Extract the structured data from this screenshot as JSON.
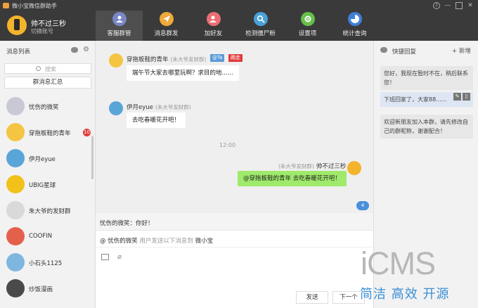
{
  "window": {
    "title": "微小宝微信群助手",
    "controls": [
      "?",
      "—",
      "□",
      "✕"
    ]
  },
  "profile": {
    "name": "帅不过三秒",
    "subtitle": "切换账号"
  },
  "nav": {
    "items": [
      {
        "label": "客服群管",
        "color": "#7b86c6",
        "active": true
      },
      {
        "label": "消息群发",
        "color": "#f0a93a",
        "active": false
      },
      {
        "label": "加好友",
        "color": "#ea6e73",
        "active": false
      },
      {
        "label": "检测僵尸粉",
        "color": "#4aa1d8",
        "active": false
      },
      {
        "label": "设置项",
        "color": "#66c04a",
        "active": false
      },
      {
        "label": "统计查询",
        "color": "#3f7fd8",
        "active": false
      }
    ]
  },
  "left": {
    "title": "消息列表",
    "search_placeholder": "搜索",
    "summary_button": "群消息汇总",
    "conversations": [
      {
        "name": "忧伤的微笑",
        "badge": "",
        "color": "#c9c9d6"
      },
      {
        "name": "穿拖板鞋的青年",
        "badge": "10",
        "color": "#f4c542"
      },
      {
        "name": "伊月eyue",
        "badge": "",
        "color": "#5aa5d8"
      },
      {
        "name": "UBIG星球",
        "badge": "",
        "color": "#f2c21a"
      },
      {
        "name": "朱大爷的发财群",
        "badge": "",
        "color": "#d9d9d9"
      },
      {
        "name": "COOFIN",
        "badge": "",
        "color": "#e4604a"
      },
      {
        "name": "小石头1125",
        "badge": "",
        "color": "#7fb6e0"
      },
      {
        "name": "炒饭漫画",
        "badge": "",
        "color": "#4a4a4a"
      }
    ]
  },
  "chat": {
    "messages": [
      {
        "sender": "穿拖板鞋的青年",
        "group": "(朱大爷发财群)",
        "tags": [
          "@Ta",
          "踢走"
        ],
        "text": "端午节大家去哪里玩啊？求目的地......"
      },
      {
        "sender": "伊月eyue",
        "group": "(朱大爷发财群)",
        "tags": [],
        "text": "去吃春暖花开吧！"
      }
    ],
    "time_divider": "12:00",
    "my_message": {
      "group": "(朱大爷发财群)",
      "sender": "帅不过三秒",
      "text": "@穿拖板鞋的青年 去吃春暖花开吧！"
    },
    "unread_count": "4",
    "reply_preview": "忧伤的微笑：你好！",
    "at_line": {
      "name": "忧伤的微笑",
      "hint": "用户发送以下消息到",
      "target": "微小宝"
    },
    "send_button": "发送",
    "next_button": "下一个"
  },
  "right": {
    "title": "快捷回复",
    "add_button": "新增",
    "replies": [
      "您好，我现在暂时不在，稍后联系您！",
      "下班回家了，大家88......",
      "欢迎新朋友加入本群，请先修改自己的群昵称，谢谢配合！"
    ]
  },
  "watermark": {
    "logo": "iCMS",
    "slogan": "简洁 高效 开源"
  }
}
